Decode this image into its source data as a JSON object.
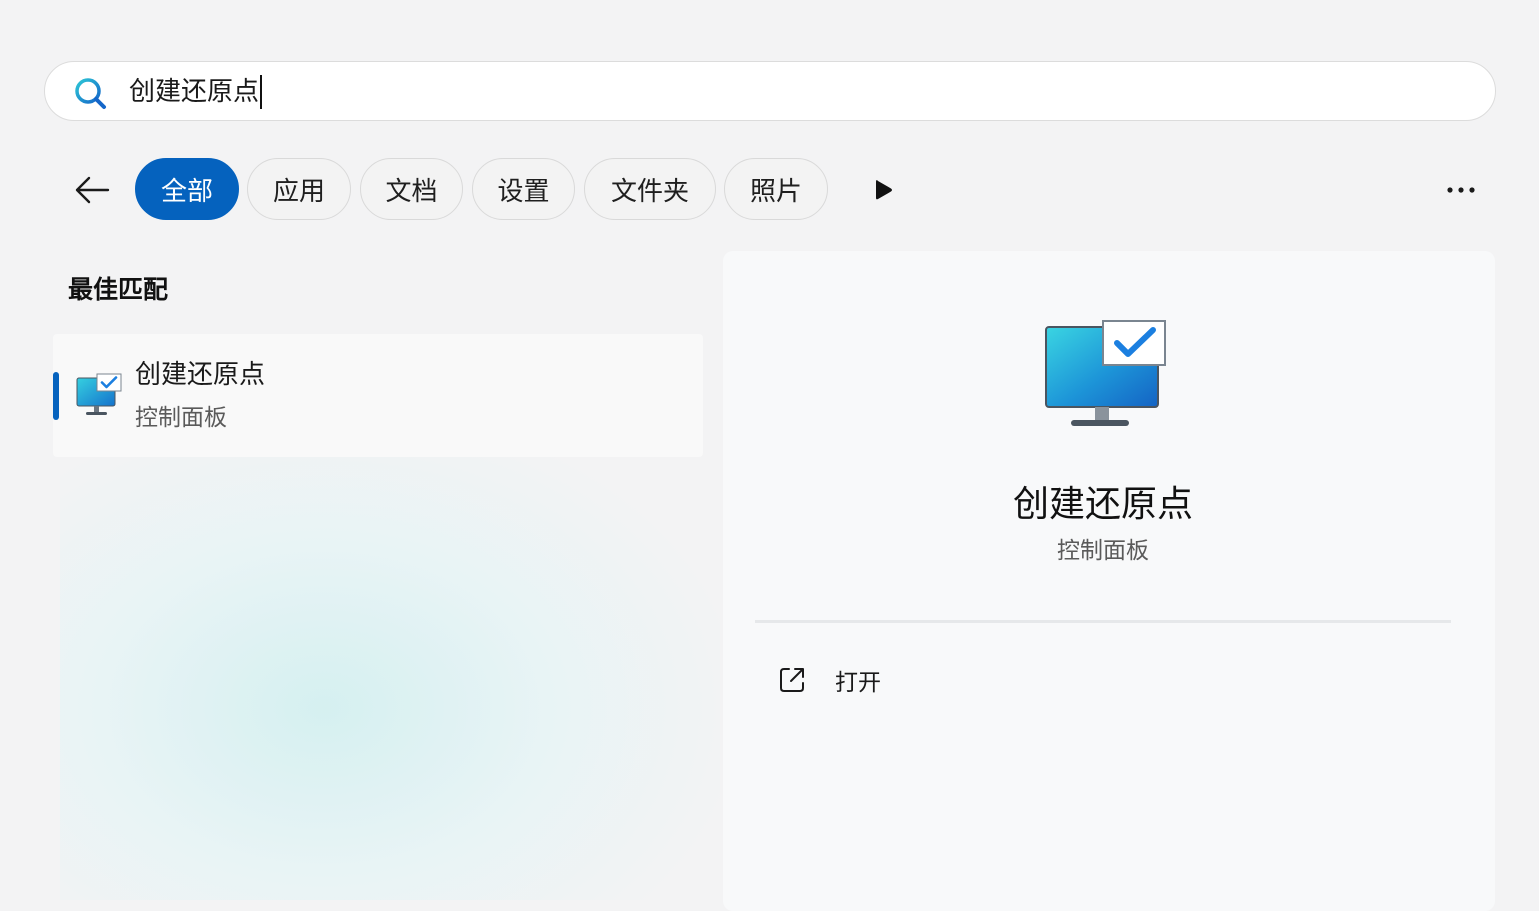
{
  "search": {
    "value": "创建还原点",
    "icon": "search-icon"
  },
  "filters": {
    "back_icon": "back-arrow-icon",
    "chips": [
      {
        "label": "全部",
        "active": true
      },
      {
        "label": "应用",
        "active": false
      },
      {
        "label": "文档",
        "active": false
      },
      {
        "label": "设置",
        "active": false
      },
      {
        "label": "文件夹",
        "active": false
      },
      {
        "label": "照片",
        "active": false
      }
    ],
    "more_icon": "play-icon",
    "options_icon": "more-horizontal-icon"
  },
  "best_match": {
    "heading": "最佳匹配",
    "result": {
      "title": "创建还原点",
      "subtitle": "控制面板",
      "icon": "monitor-check-icon"
    }
  },
  "detail": {
    "title": "创建还原点",
    "subtitle": "控制面板",
    "icon": "monitor-check-icon",
    "actions": [
      {
        "label": "打开",
        "icon": "open-external-icon"
      }
    ]
  },
  "colors": {
    "accent": "#0562be",
    "background": "#f3f3f4",
    "panel": "#f8f9fa"
  }
}
